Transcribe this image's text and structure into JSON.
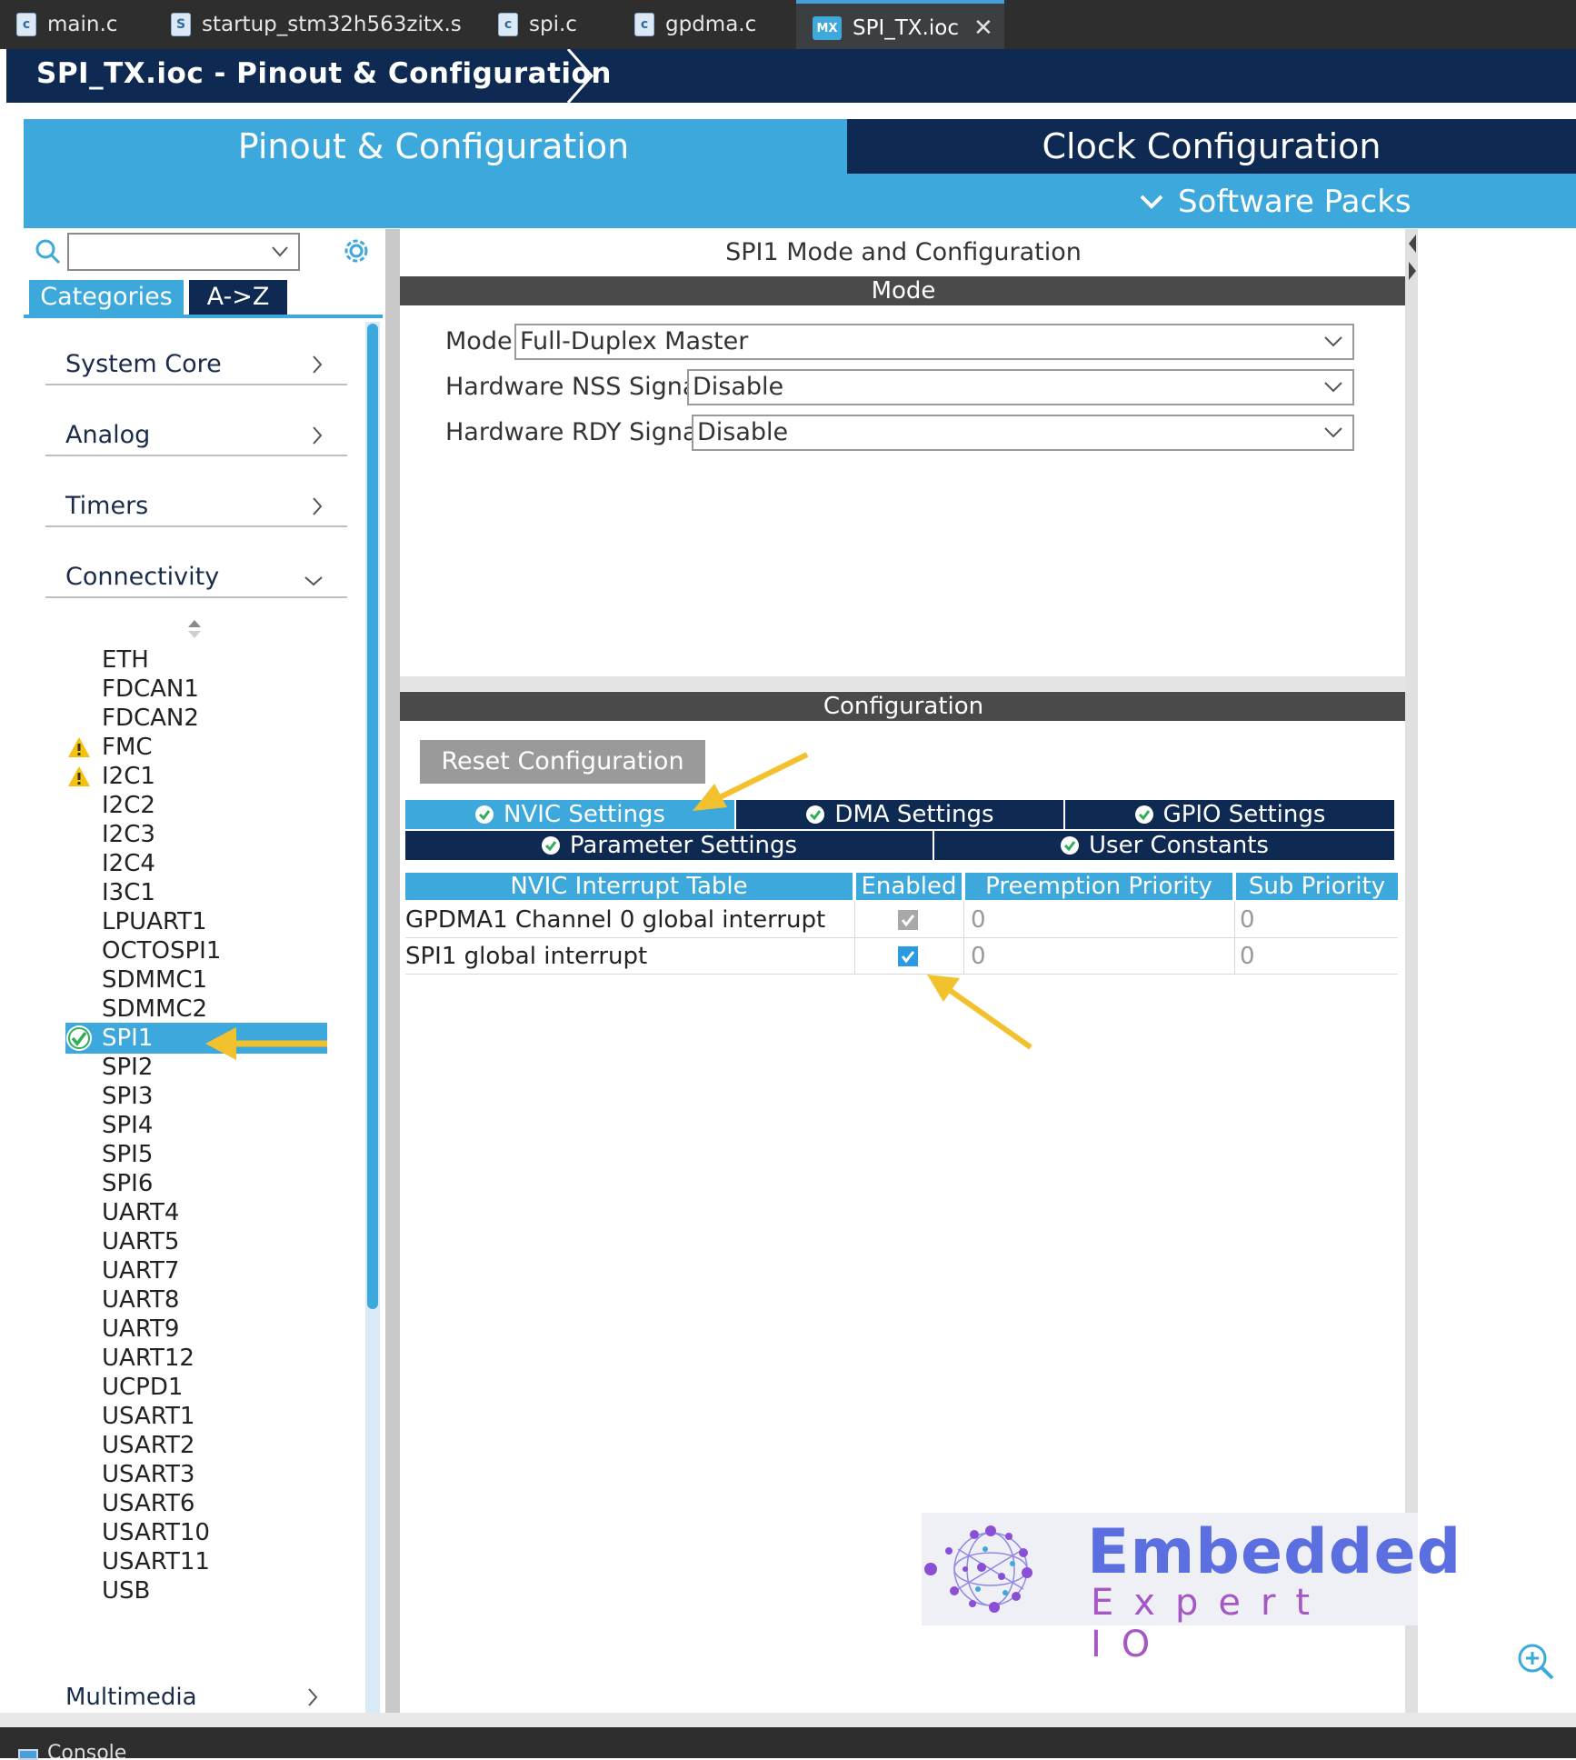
{
  "editor_tabs": [
    {
      "label": "main.c",
      "icon": "c-file-icon"
    },
    {
      "label": "startup_stm32h563zitx.s",
      "icon": "s-file-icon"
    },
    {
      "label": "spi.c",
      "icon": "c-file-icon"
    },
    {
      "label": "gpdma.c",
      "icon": "c-file-icon"
    },
    {
      "label": "SPI_TX.ioc",
      "icon": "mx-file-icon",
      "active": true
    }
  ],
  "breadcrumb": "SPI_TX.ioc - Pinout & Configuration",
  "main_tabs": {
    "pinout": "Pinout & Configuration",
    "clock": "Clock Configuration",
    "software_packs": "Software Packs"
  },
  "left": {
    "search_value": "",
    "tab_categories": "Categories",
    "tab_az": "A->Z",
    "categories": [
      {
        "label": "System Core",
        "state": "collapsed"
      },
      {
        "label": "Analog",
        "state": "collapsed"
      },
      {
        "label": "Timers",
        "state": "collapsed"
      },
      {
        "label": "Connectivity",
        "state": "expanded"
      }
    ],
    "connectivity_items": [
      {
        "label": "ETH"
      },
      {
        "label": "FDCAN1"
      },
      {
        "label": "FDCAN2"
      },
      {
        "label": "FMC",
        "status": "warning"
      },
      {
        "label": "I2C1",
        "status": "warning"
      },
      {
        "label": "I2C2"
      },
      {
        "label": "I2C3"
      },
      {
        "label": "I2C4"
      },
      {
        "label": "I3C1"
      },
      {
        "label": "LPUART1"
      },
      {
        "label": "OCTOSPI1"
      },
      {
        "label": "SDMMC1"
      },
      {
        "label": "SDMMC2"
      },
      {
        "label": "SPI1",
        "status": "ok",
        "selected": true
      },
      {
        "label": "SPI2"
      },
      {
        "label": "SPI3"
      },
      {
        "label": "SPI4"
      },
      {
        "label": "SPI5"
      },
      {
        "label": "SPI6"
      },
      {
        "label": "UART4"
      },
      {
        "label": "UART5"
      },
      {
        "label": "UART7"
      },
      {
        "label": "UART8"
      },
      {
        "label": "UART9"
      },
      {
        "label": "UART12"
      },
      {
        "label": "UCPD1"
      },
      {
        "label": "USART1"
      },
      {
        "label": "USART2"
      },
      {
        "label": "USART3"
      },
      {
        "label": "USART6"
      },
      {
        "label": "USART10"
      },
      {
        "label": "USART11"
      },
      {
        "label": "USB"
      }
    ],
    "multimedia": "Multimedia"
  },
  "panel": {
    "title": "SPI1 Mode and Configuration",
    "mode_header": "Mode",
    "mode_fields": [
      {
        "label": "Mode",
        "value": "Full-Duplex Master"
      },
      {
        "label": "Hardware NSS Signal",
        "value": "Disable"
      },
      {
        "label": "Hardware RDY Signal",
        "value": "Disable"
      }
    ],
    "config_header": "Configuration",
    "reset_button": "Reset Configuration",
    "settings_tabs": [
      {
        "label": "NVIC Settings",
        "active": true
      },
      {
        "label": "DMA Settings"
      },
      {
        "label": "GPIO Settings"
      },
      {
        "label": "Parameter Settings"
      },
      {
        "label": "User Constants"
      }
    ],
    "nvic_table": {
      "headers": [
        "NVIC Interrupt Table",
        "Enabled",
        "Preemption Priority",
        "Sub Priority"
      ],
      "rows": [
        {
          "name": "GPDMA1 Channel 0 global interrupt",
          "enabled": true,
          "locked": true,
          "preemption": "0",
          "sub": "0"
        },
        {
          "name": "SPI1 global interrupt",
          "enabled": true,
          "locked": false,
          "preemption": "0",
          "sub": "0"
        }
      ]
    }
  },
  "logo": {
    "line1": "Embedded",
    "line2": "Expert IO"
  },
  "status_bar_text": "Console",
  "colors": {
    "accent_blue": "#3ca8db",
    "navy": "#0e2a52",
    "annotation_arrow": "#f2c12e",
    "ok_green": "#2fae5a",
    "warning_yellow": "#f4c20d"
  }
}
